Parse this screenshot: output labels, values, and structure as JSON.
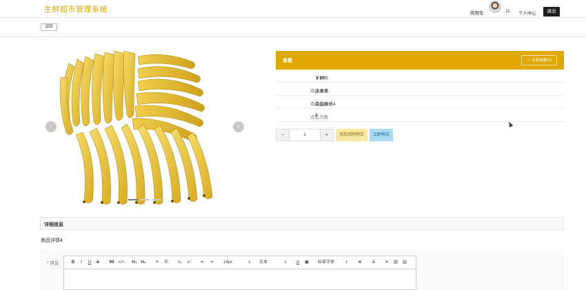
{
  "header": {
    "title": "生鲜超市管理系统",
    "cart_label": "购物车",
    "user_number": "11",
    "profile_label": "个人中心",
    "logout_label": "退出"
  },
  "subbar": {
    "back_label": "返回"
  },
  "carousel": {
    "prev_icon": "chevron-left-icon",
    "next_icon": "chevron-right-icon",
    "prev_glyph": "‹",
    "next_glyph": "›"
  },
  "product": {
    "name": "香蕉",
    "favorite_label": "点我收藏(4)",
    "rows": [
      {
        "label": "价格",
        "value": "￥20"
      },
      {
        "label": "商品分类",
        "value": "水果类"
      },
      {
        "label": "商品规格",
        "value": "商品规格4"
      },
      {
        "label": "点击次数",
        "value": "8"
      }
    ],
    "quantity": "1",
    "minus": "−",
    "plus": "+",
    "add_to_cart_label": "添加到购物车",
    "buy_now_label": "立即购买"
  },
  "details": {
    "section_title": "详细信息",
    "description": "商品详情4",
    "comment_label": "评论",
    "required_mark": "*"
  },
  "editor_toolbar": {
    "bold": "B",
    "italic": "I",
    "underline": "U",
    "strike": "S",
    "quote": "99",
    "code": "</>",
    "h1": "H₁",
    "h2": "H₂",
    "sub": "x₁",
    "sup": "x²",
    "font_size": "14px",
    "text_type": "文本",
    "font_family": "标准字体"
  },
  "colors": {
    "accent": "#e0a800",
    "logout_bg": "#1f1f1f",
    "add_cart_bg": "#fbe7a1",
    "buy_now_bg": "#a9dcf3"
  }
}
